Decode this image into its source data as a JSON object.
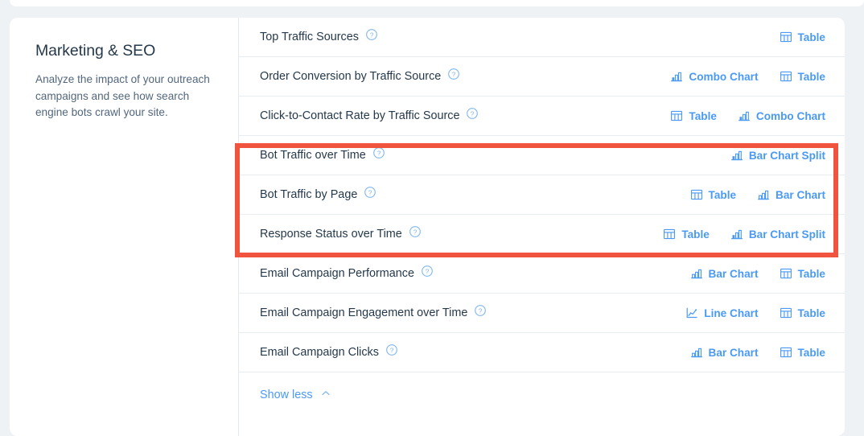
{
  "section": {
    "title": "Marketing & SEO",
    "description": "Analyze the impact of your outreach campaigns and see how search engine bots crawl your site."
  },
  "colors": {
    "link": "#4a9af5",
    "text": "#25394b",
    "muted": "#52677d",
    "highlight": "#f0543f",
    "row_divider": "#e8edf2",
    "page_background": "#eef2f5",
    "card_background": "#ffffff"
  },
  "help_icon_name": "help-circle-icon",
  "rows": [
    {
      "label": "Top Traffic Sources",
      "actions": [
        {
          "label": "Table",
          "icon": "table-icon"
        }
      ]
    },
    {
      "label": "Order Conversion by Traffic Source",
      "actions": [
        {
          "label": "Combo Chart",
          "icon": "combo-chart-icon"
        },
        {
          "label": "Table",
          "icon": "table-icon"
        }
      ]
    },
    {
      "label": "Click-to-Contact Rate by Traffic Source",
      "actions": [
        {
          "label": "Table",
          "icon": "table-icon"
        },
        {
          "label": "Combo Chart",
          "icon": "combo-chart-icon"
        }
      ]
    },
    {
      "label": "Bot Traffic over Time",
      "actions": [
        {
          "label": "Bar Chart Split",
          "icon": "bar-chart-split-icon"
        }
      ]
    },
    {
      "label": "Bot Traffic by Page",
      "actions": [
        {
          "label": "Table",
          "icon": "table-icon"
        },
        {
          "label": "Bar Chart",
          "icon": "bar-chart-icon"
        }
      ]
    },
    {
      "label": "Response Status over Time",
      "actions": [
        {
          "label": "Table",
          "icon": "table-icon"
        },
        {
          "label": "Bar Chart Split",
          "icon": "bar-chart-split-icon"
        }
      ]
    },
    {
      "label": "Email Campaign Performance",
      "actions": [
        {
          "label": "Bar Chart",
          "icon": "bar-chart-icon"
        },
        {
          "label": "Table",
          "icon": "table-icon"
        }
      ]
    },
    {
      "label": "Email Campaign Engagement over Time",
      "actions": [
        {
          "label": "Line Chart",
          "icon": "line-chart-icon"
        },
        {
          "label": "Table",
          "icon": "table-icon"
        }
      ]
    },
    {
      "label": "Email Campaign Clicks",
      "actions": [
        {
          "label": "Bar Chart",
          "icon": "bar-chart-icon"
        },
        {
          "label": "Table",
          "icon": "table-icon"
        }
      ]
    }
  ],
  "footer": {
    "show_less_label": "Show less",
    "show_less_icon": "chevron-up-icon"
  },
  "highlight": {
    "present": true,
    "highlighted_row_labels": [
      "Bot Traffic over Time",
      "Bot Traffic by Page",
      "Response Status over Time"
    ]
  }
}
